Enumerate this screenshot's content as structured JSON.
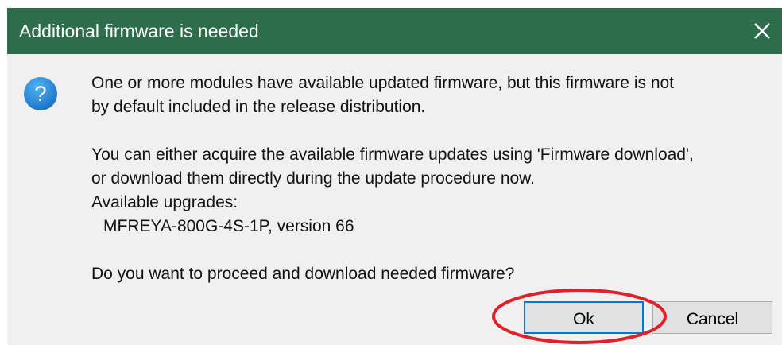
{
  "dialog": {
    "title": "Additional firmware is needed",
    "close_icon": "close-icon",
    "question_icon": "question-icon",
    "message": {
      "line1": "One or more modules have available updated firmware, but this firmware is not",
      "line2": "by default included in the release distribution.",
      "line3": "You can either acquire the available firmware updates using 'Firmware download',",
      "line4": "or download them directly during the update procedure now.",
      "line5": "Available upgrades:",
      "line6": "MFREYA-800G-4S-1P, version 66",
      "line7": "Do you want to proceed and download needed firmware?"
    },
    "buttons": {
      "ok": "Ok",
      "cancel": "Cancel"
    }
  },
  "colors": {
    "titlebar": "#2e6d4c",
    "dialog_bg": "#f0f0f0",
    "highlight_circle": "#e0202a",
    "default_button_border": "#0078d7"
  }
}
